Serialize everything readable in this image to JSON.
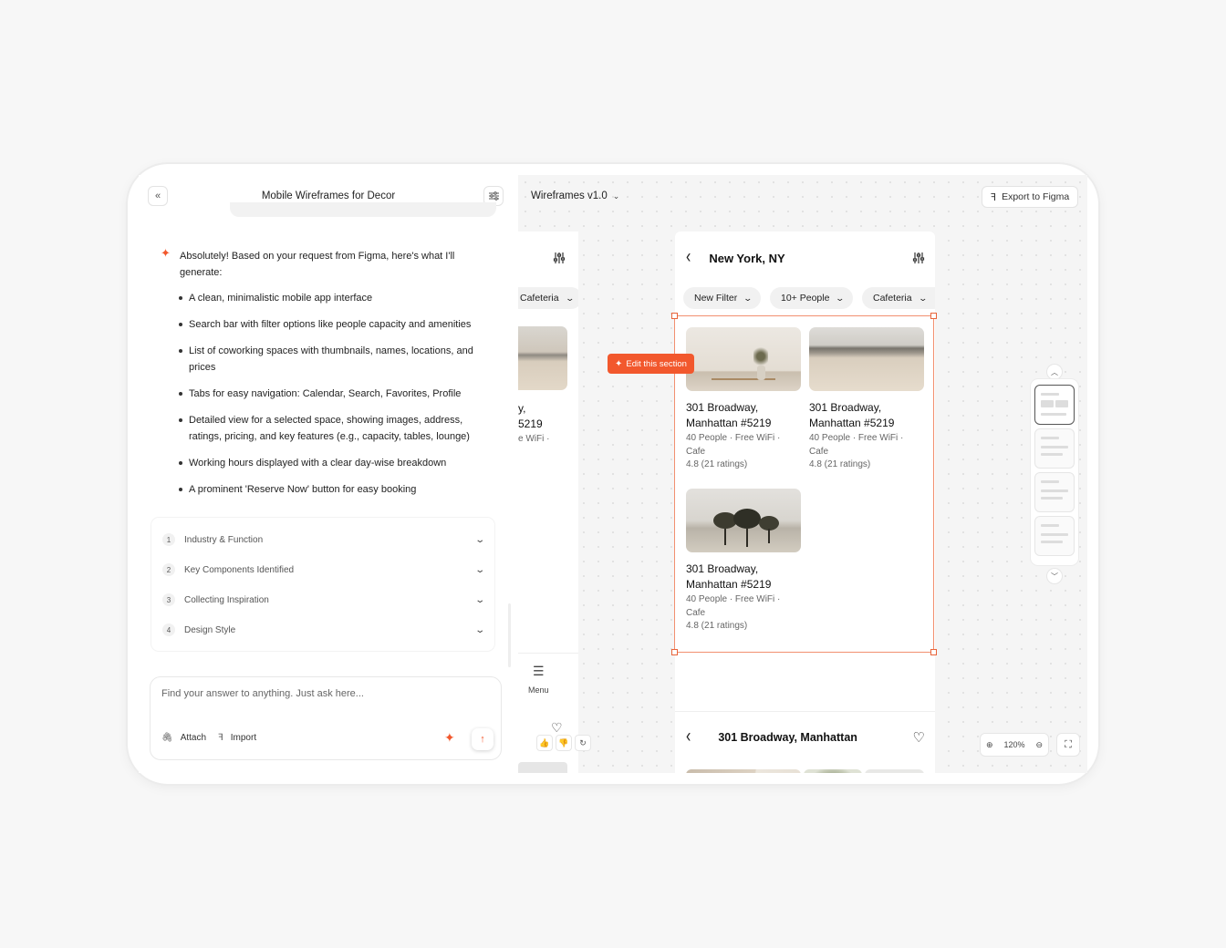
{
  "left_panel": {
    "collapse_icon": "chevrons-left-icon",
    "title": "Mobile Wireframes for Decor",
    "settings_icon": "sliders-icon",
    "ai_message": {
      "intro": "Absolutely! Based on your request from Figma, here's what I'll generate:",
      "bullets": [
        "A clean, minimalistic mobile app interface",
        "Search bar with filter options like people capacity and amenities",
        "List of coworking spaces with thumbnails, names, locations, and prices",
        "Tabs for easy navigation: Calendar, Search, Favorites, Profile",
        "Detailed view for a selected space, showing images, address, ratings, pricing, and key features (e.g., capacity, tables, lounge)",
        "Working hours displayed with a clear day-wise breakdown",
        "A prominent 'Reserve Now' button for easy booking"
      ]
    },
    "steps": [
      {
        "num": "1",
        "label": "Industry & Function"
      },
      {
        "num": "2",
        "label": "Key Components Identified"
      },
      {
        "num": "3",
        "label": "Collecting Inspiration"
      },
      {
        "num": "4",
        "label": "Design Style"
      }
    ],
    "prompt": {
      "placeholder": "Find your answer to anything. Just ask here...",
      "attach_label": "Attach",
      "import_label": "Import"
    }
  },
  "canvas": {
    "version": "Wireframes v1.0",
    "export_label": "Export to Figma",
    "edit_section_label": "Edit this section",
    "partial_screen": {
      "chip": "Cafeteria",
      "title_fragment_1": "y,",
      "title_fragment_2": "5219",
      "sub_fragment": "e WiFi ·",
      "menu_label": "Menu"
    },
    "phone": {
      "city": "New York, NY",
      "chips": [
        "New Filter",
        "10+ People",
        "Cafeteria"
      ],
      "listings": [
        {
          "title": "301 Broadway, Manhattan #5219",
          "features": "40 People · Free WiFi · Cafe",
          "rating": "4.8 (21 ratings)"
        },
        {
          "title": "301 Broadway, Manhattan #5219",
          "features": "40 People · Free WiFi · Cafe",
          "rating": "4.8 (21 ratings)"
        },
        {
          "title": "301 Broadway, Manhattan #5219",
          "features": "40 People · Free WiFi · Cafe",
          "rating": "4.8 (21 ratings)"
        }
      ],
      "detail_title": "301 Broadway, Manhattan"
    },
    "zoom_level": "120%"
  }
}
